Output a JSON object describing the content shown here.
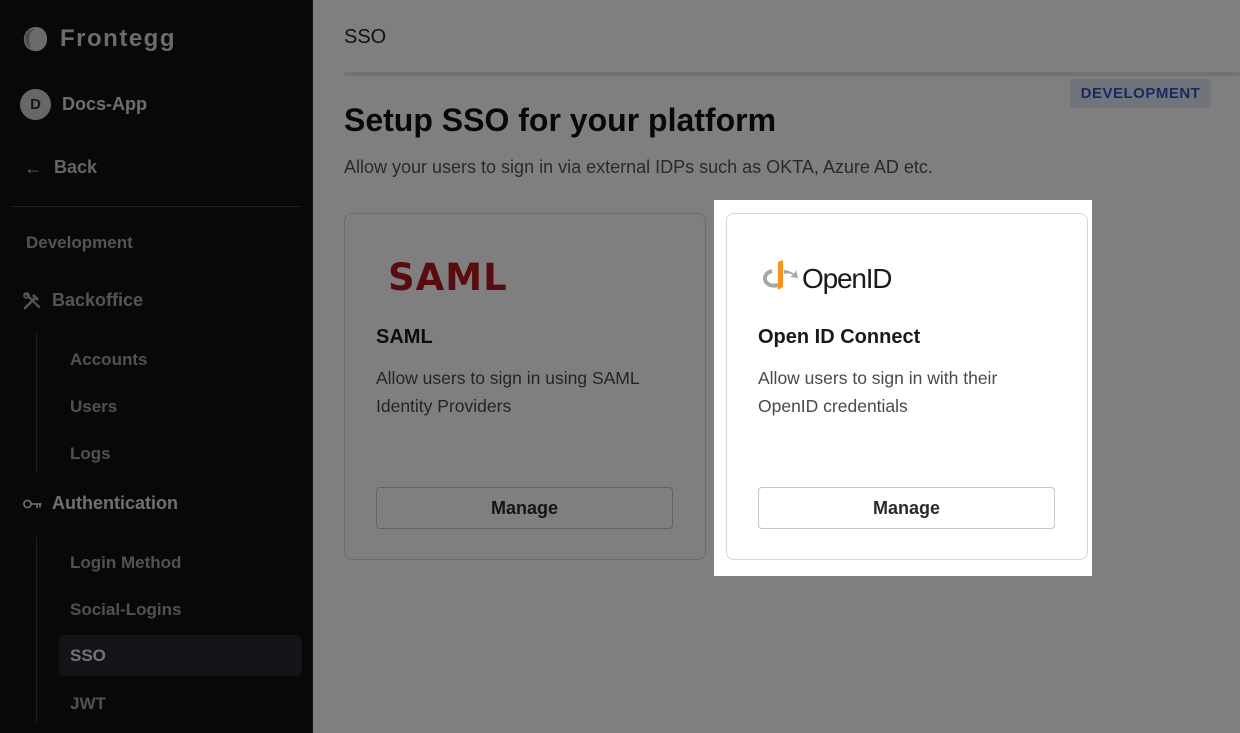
{
  "sidebar": {
    "brand": "Frontegg",
    "app": {
      "initial": "D",
      "name": "Docs-App"
    },
    "back_label": "Back",
    "section_label": "Development",
    "backoffice": {
      "label": "Backoffice",
      "items": [
        "Accounts",
        "Users",
        "Logs"
      ]
    },
    "authentication": {
      "label": "Authentication",
      "items": [
        "Login Method",
        "Social-Logins",
        "SSO",
        "JWT"
      ],
      "active": "SSO"
    }
  },
  "main": {
    "topbar_title": "SSO",
    "env_badge": "DEVELOPMENT",
    "title": "Setup SSO for your platform",
    "subtitle": "Allow your users to sign in via external IDPs such as OKTA, Azure AD etc.",
    "cards": [
      {
        "logo_text": "SAML",
        "title": "SAML",
        "description": "Allow users to sign in using SAML Identity Providers",
        "button": "Manage"
      },
      {
        "logo_text": "OpenID",
        "title": "Open ID Connect",
        "description": "Allow users to sign in with their OpenID credentials",
        "button": "Manage"
      }
    ]
  },
  "colors": {
    "sidebar_bg": "#111111",
    "saml_red": "#b3191d",
    "openid_orange": "#f7931e",
    "badge_text": "#3551c4",
    "badge_bg": "#e3e8f6"
  },
  "icons": {
    "brand": "frontegg-logo-icon",
    "back": "arrow-left-icon",
    "backoffice": "tools-icon",
    "authentication": "key-icon"
  }
}
